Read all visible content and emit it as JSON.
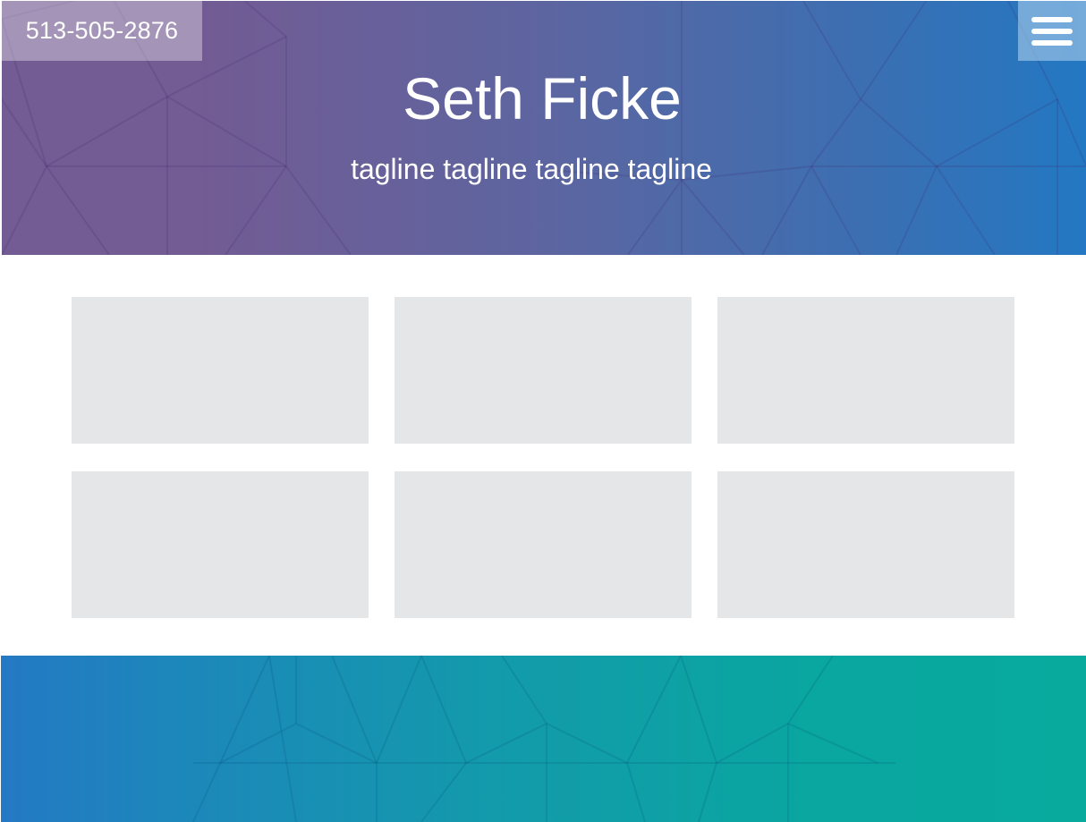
{
  "header": {
    "phone": "513-505-2876",
    "title": "Seth Ficke",
    "tagline": "tagline tagline tagline tagline",
    "menu_icon": "hamburger-menu-icon",
    "gradient_colors": [
      "#735b93",
      "#2378c3"
    ]
  },
  "grid": {
    "card_count": 6,
    "card_color": "#e5e6e8"
  },
  "footer": {
    "gradient_colors": [
      "#2479c4",
      "#08aa9e"
    ]
  }
}
